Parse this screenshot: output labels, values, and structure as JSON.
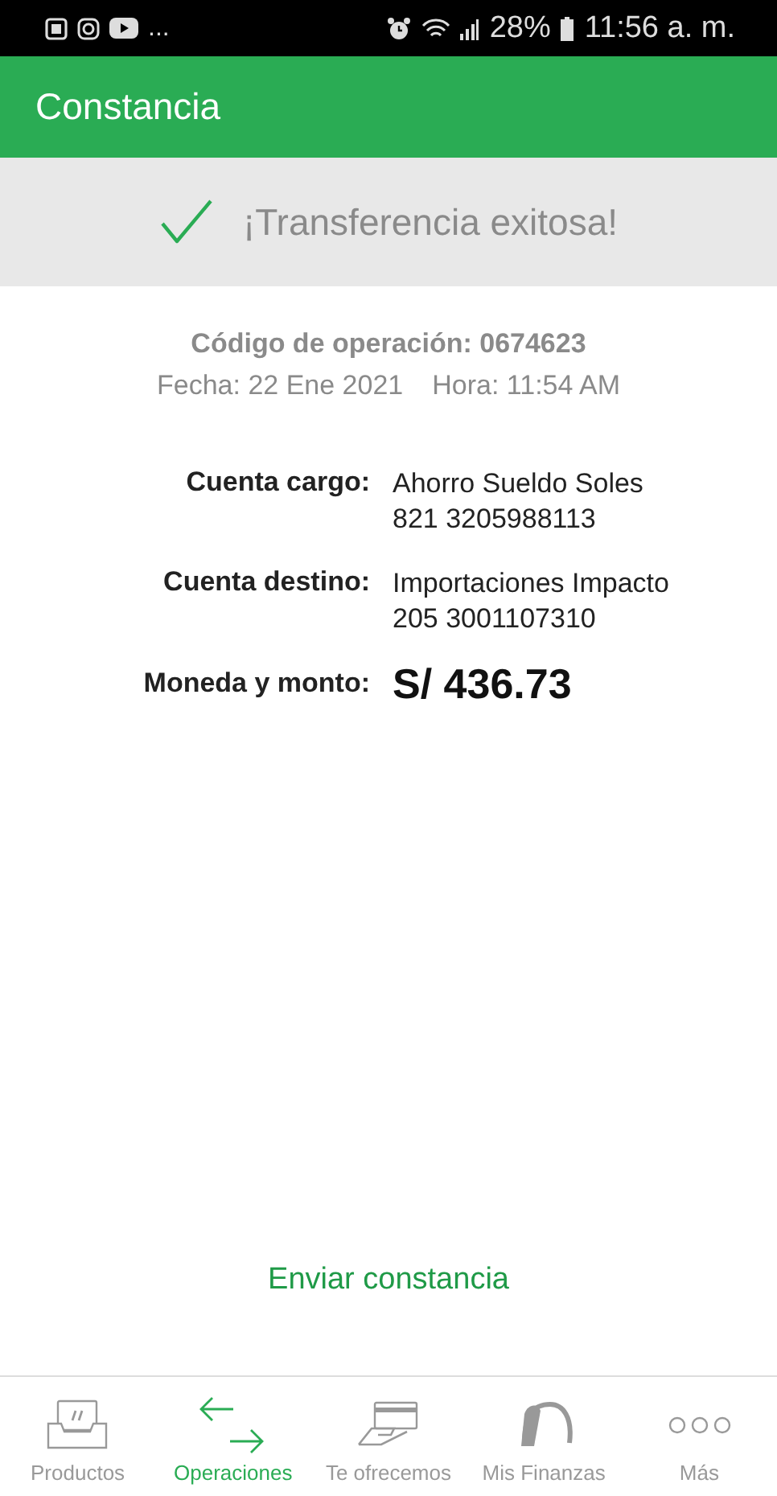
{
  "status_bar": {
    "more": "...",
    "battery": "28%",
    "time": "11:56 a. m."
  },
  "header": {
    "title": "Constancia"
  },
  "banner": {
    "message": "¡Transferencia exitosa!"
  },
  "operation": {
    "code": "Código de operación: 0674623",
    "date": "Fecha: 22 Ene 2021",
    "time": "Hora: 11:54 AM"
  },
  "details": [
    {
      "kind": "text",
      "label": "Cuenta cargo:",
      "lines": [
        "Ahorro Sueldo Soles",
        "821 3205988113"
      ]
    },
    {
      "kind": "text",
      "label": "Cuenta destino:",
      "lines": [
        "Importaciones Impacto",
        "205 3001107310"
      ]
    },
    {
      "kind": "amount",
      "label": "Moneda y monto:",
      "lines": [
        "S/ 436.73"
      ]
    }
  ],
  "send_link": "Enviar constancia",
  "bottom_nav": [
    {
      "kind": "products",
      "label": "Productos",
      "selected": false
    },
    {
      "kind": "operations",
      "label": "Operaciones",
      "selected": true
    },
    {
      "kind": "offers",
      "label": "Te ofrecemos",
      "selected": false
    },
    {
      "kind": "finances",
      "label": "Mis Finanzas",
      "selected": false
    },
    {
      "kind": "more",
      "label": "Más",
      "selected": false
    }
  ]
}
